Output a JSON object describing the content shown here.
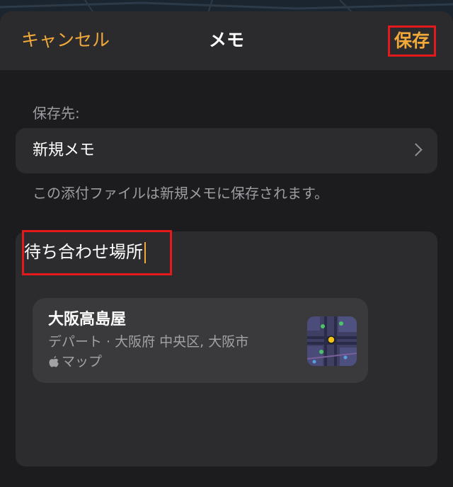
{
  "navbar": {
    "cancel_label": "キャンセル",
    "title": "メモ",
    "save_label": "保存"
  },
  "destination": {
    "label": "保存先:",
    "value": "新規メモ",
    "note": "この添付ファイルは新規メモに保存されます。"
  },
  "note": {
    "title": "待ち合わせ場所"
  },
  "place": {
    "name": "大阪高島屋",
    "subtitle": "デパート · 大阪府 中央区, 大阪市",
    "source": "マップ"
  },
  "colors": {
    "accent": "#f3a93a",
    "highlight_border": "#e3191c"
  }
}
